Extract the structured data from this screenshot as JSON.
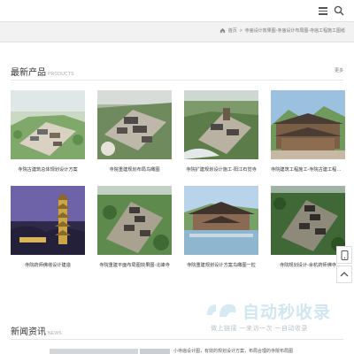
{
  "header": {
    "menu_icon": "hamburger-menu-icon",
    "search_icon": "search-icon"
  },
  "breadcrumb": {
    "home_icon": "home-icon",
    "items": [
      "首页",
      "寺庙设计效果图-寺庙设计布局图-寺庙工程施工图纸"
    ],
    "separator": ">"
  },
  "products": {
    "title": "最新产品",
    "title_en": "PRODUCTS",
    "more": "更多",
    "items": [
      {
        "caption": "寺院古建筑总体规划设计方案"
      },
      {
        "caption": "寺院重建规划布局鸟瞰图"
      },
      {
        "caption": "寺院扩建规划设计施工-阳江石觉寺"
      },
      {
        "caption": "寺院建筑工程施工-寺院古建工程施工"
      },
      {
        "caption": "寺院药师佛塔设计建造"
      },
      {
        "caption": "寺院重建平面布局图效果图-北峰寺"
      },
      {
        "caption": "寺院重建规划设计方案鸟瞰图一粒"
      },
      {
        "caption": "寺院规划设计-余杭药师佛寺"
      }
    ]
  },
  "news": {
    "title": "新闻资讯",
    "title_en": "NEWS",
    "snippet": "小寺庙设计图，有效的规划设计方案，布局合理的寺院布局图"
  },
  "floating": {
    "phone_icon": "phone-icon",
    "top_icon": "arrow-up-icon"
  },
  "watermark": {
    "title": "自动秒收录",
    "subtitle": "做上链接 一来访一次 一自动收录"
  },
  "colors": {
    "breadcrumb_bg": "#f2f2f2",
    "text": "#333333",
    "muted": "#999999"
  }
}
